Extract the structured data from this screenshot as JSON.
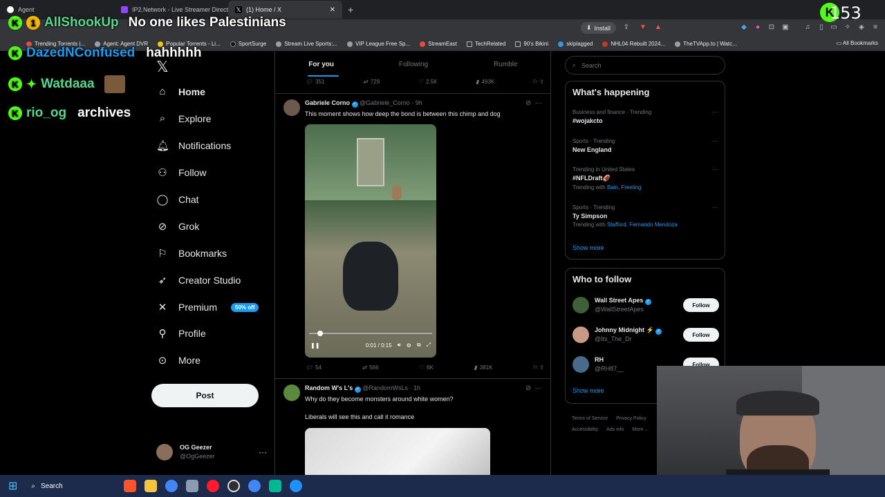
{
  "browser": {
    "tabs": [
      {
        "title": "Agent",
        "favicon_color": "#ffffff"
      },
      {
        "title": "IP2.Network - Live Streamer Directo",
        "favicon_color": "#9146ff"
      },
      {
        "title": "(1) Home / X",
        "favicon_color": "#ffffff"
      }
    ],
    "install_label": "Install",
    "bookmarks": [
      "Trending Torrents |...",
      "Agent: Agent DVR",
      "Popular Torrents - Li...",
      "SportSurge",
      "Stream Live Sports:...",
      "VIP League Free Sp...",
      "StreamEast",
      "TechRelated",
      "90's Bikini",
      "skiplagged",
      "NHL04 Rebuilt 2024...",
      "TheTVApp.to | Watc..."
    ],
    "all_bookmarks": "All Bookmarks"
  },
  "chat_overlay": [
    {
      "user": "AllShookUp",
      "message": "No one likes Palestinians",
      "badge": "1"
    },
    {
      "user": "DazedNConfused",
      "message": "hahhhhh",
      "badge": ""
    },
    {
      "user": "Watdaaa",
      "message": "",
      "badge": ""
    },
    {
      "user": "rio_og",
      "message": "archives",
      "badge": ""
    }
  ],
  "stream_counter": "153",
  "sidebar": {
    "items": [
      {
        "label": "Home",
        "icon": "home-icon"
      },
      {
        "label": "Explore",
        "icon": "search-icon"
      },
      {
        "label": "Notifications",
        "icon": "bell-icon"
      },
      {
        "label": "Follow",
        "icon": "person-add-icon"
      },
      {
        "label": "Chat",
        "icon": "chat-icon"
      },
      {
        "label": "Grok",
        "icon": "grok-icon"
      },
      {
        "label": "Bookmarks",
        "icon": "bookmark-icon"
      },
      {
        "label": "Creator Studio",
        "icon": "rocket-icon"
      },
      {
        "label": "Premium",
        "icon": "x-icon"
      },
      {
        "label": "Profile",
        "icon": "person-icon"
      },
      {
        "label": "More",
        "icon": "more-icon"
      }
    ],
    "premium_badge": "50% off",
    "post_label": "Post",
    "account": {
      "name": "OG Geezer",
      "handle": "@OgGeezer"
    }
  },
  "feed": {
    "tabs": [
      "For you",
      "Following",
      "Rumble"
    ],
    "prev_actions": {
      "replies": "351",
      "reposts": "729",
      "likes": "2.5K",
      "views": "493K"
    },
    "tweets": [
      {
        "name": "Gabriele Corno",
        "handle": "@Gabriele_Corno",
        "time": "9h",
        "text": "This moment shows how deep the bond is between this chimp and dog",
        "video_time": "0:01 / 0:15",
        "actions": {
          "replies": "54",
          "reposts": "566",
          "likes": "6K",
          "views": "381K"
        }
      },
      {
        "name": "Random W's L's",
        "handle": "@RandomWsLs",
        "time": "1h",
        "text": "Why do they become monsters around white women?",
        "text2": "Liberals will see this and call it romance"
      }
    ]
  },
  "right": {
    "search_placeholder": "Search",
    "whats_happening": "What's happening",
    "trends": [
      {
        "context": "Business and finance · Trending",
        "name": "#wojakcto",
        "with": ""
      },
      {
        "context": "Sports · Trending",
        "name": "New England",
        "with": ""
      },
      {
        "context": "Trending in United States",
        "name": "#NFLDraft🏈",
        "with_prefix": "Trending with",
        "with": "Bain, Freeling"
      },
      {
        "context": "Sports · Trending",
        "name": "Ty Simpson",
        "with_prefix": "Trending with",
        "with": "Stafford, Fernando Mendoza"
      }
    ],
    "show_more": "Show more",
    "who_to_follow": "Who to follow",
    "follow_suggestions": [
      {
        "name": "Wall Street Apes",
        "handle": "@WallStreetApes",
        "verified": true
      },
      {
        "name": "Johnny Midnight ⚡",
        "handle": "@Its_The_Dr",
        "verified": true
      },
      {
        "name": "RH",
        "handle": "@RH87__",
        "verified": false
      }
    ],
    "follow_label": "Follow",
    "footer": [
      "Terms of Service",
      "Privacy Policy",
      "Accessibility",
      "Ads info",
      "More ..."
    ]
  },
  "taskbar": {
    "search_label": "Search"
  }
}
